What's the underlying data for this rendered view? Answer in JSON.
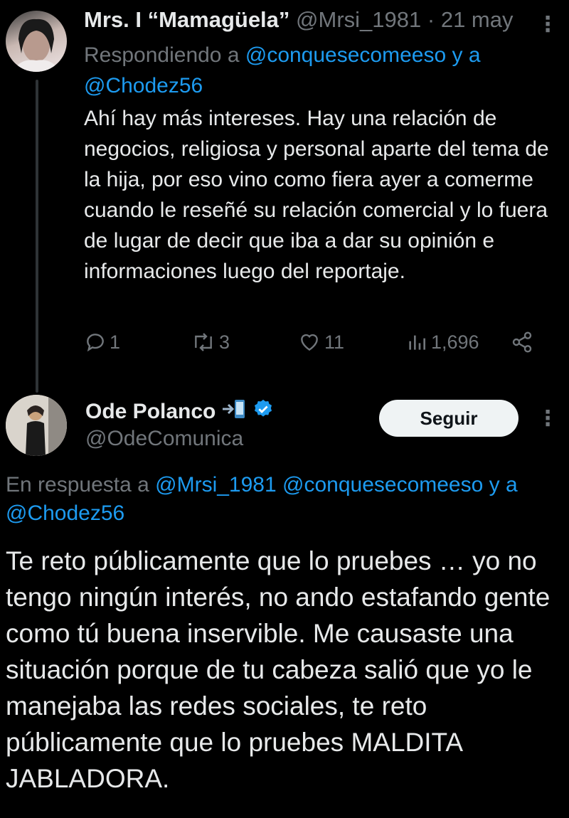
{
  "tweet1": {
    "display_name": "Mrs. I “Mamagüela”",
    "handle": "@Mrsi_1981",
    "date": "· 21 may",
    "reply_prefix": "Respondiendo a",
    "reply_user1": "@conquesecomeeso",
    "reply_and": "y a",
    "reply_user2": "@Chodez56",
    "body": "Ahí hay más intereses. Hay una relación de negocios, religiosa  y personal aparte del tema de la hija, por eso vino como fiera ayer a comerme cuando le reseñé su relación comercial y lo fuera de lugar de decir que iba a dar su opinión e informaciones luego del reportaje.",
    "replies": "1",
    "retweets": "3",
    "likes": "11",
    "views": "1,696"
  },
  "tweet2": {
    "display_name": "Ode Polanco",
    "handle": "@OdeComunica",
    "follow_label": "Seguir",
    "reply_prefix": "En respuesta a",
    "reply_user1": "@Mrsi_1981",
    "reply_user2": "@conquesecomeeso",
    "reply_and": "y a",
    "reply_user3": "@Chodez56",
    "body": "Te reto públicamente que lo pruebes … yo no tengo ningún interés, no ando estafando gente como tú buena inservible. Me causaste una situación porque de tu cabeza salió que yo le manejaba las redes sociales, te reto públicamente que lo pruebes MALDITA JABLADORA."
  },
  "colors": {
    "background": "#000000",
    "text": "#e7e9ea",
    "muted": "#71767b",
    "link": "#1d9bf0",
    "verified": "#1d9bf0"
  },
  "icons": [
    "reply-icon",
    "retweet-icon",
    "like-icon",
    "views-icon",
    "share-icon",
    "more-icon",
    "verified-icon",
    "phone-arrow-emoji"
  ]
}
